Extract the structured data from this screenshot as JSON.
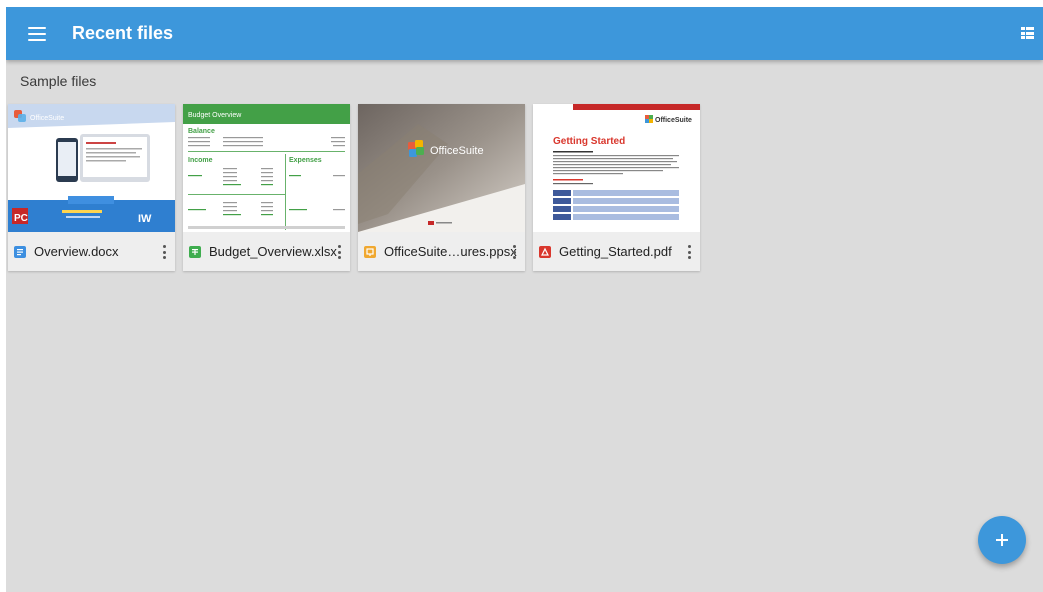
{
  "appbar": {
    "title": "Recent files",
    "menu_icon": "hamburger-menu-icon",
    "view_icon": "list-view-icon"
  },
  "section": {
    "title": "Sample files"
  },
  "files": [
    {
      "name": "Overview.docx",
      "icon": "word-doc-icon",
      "icon_color": "#3d8fe0",
      "thumb": {
        "brand": "OfficeSuite",
        "b1": "PC",
        "b2": "IW"
      }
    },
    {
      "name": "Budget_Overview.xlsx",
      "icon": "spreadsheet-icon",
      "icon_color": "#3fad4f",
      "thumb": {
        "header": "Budget Overview",
        "balance": "Balance",
        "income": "Income",
        "expenses": "Expenses"
      }
    },
    {
      "name": "OfficeSuite…ures.ppsx",
      "icon": "presentation-icon",
      "icon_color": "#f0a830",
      "thumb": {
        "brand": "OfficeSuite"
      }
    },
    {
      "name": "Getting_Started.pdf",
      "icon": "pdf-icon",
      "icon_color": "#d9372d",
      "thumb": {
        "brand": "OfficeSuite",
        "heading": "Getting Started"
      }
    }
  ],
  "fab": {
    "icon": "plus-icon"
  },
  "colors": {
    "primary": "#3d97db",
    "background": "#dcdcdc",
    "card": "#eeeeee"
  }
}
